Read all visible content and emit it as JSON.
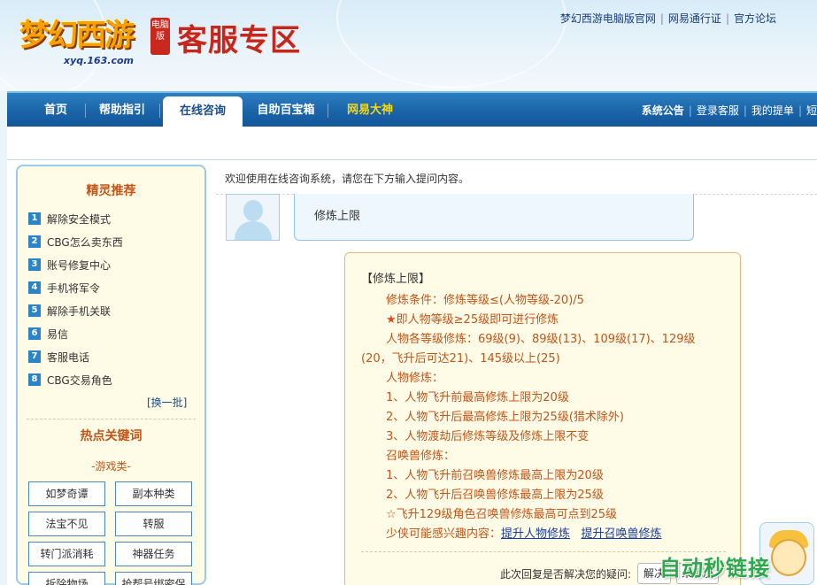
{
  "header": {
    "logo_text": "梦幻西游",
    "logo_badge": "电脑版",
    "logo_url": "xyq.163.com",
    "zone_title": "客服专区",
    "top_links": [
      "梦幻西游电脑版官网",
      "网易通行证",
      "官方论坛"
    ]
  },
  "nav": {
    "tabs": [
      {
        "label": "首页"
      },
      {
        "label": "帮助指引"
      },
      {
        "label": "在线咨询"
      },
      {
        "label": "自助百宝箱"
      },
      {
        "label": "网易大神"
      }
    ],
    "right_links": [
      "系统公告",
      "登录客服",
      "我的提单",
      "短"
    ]
  },
  "sidebar": {
    "rec_title": "精灵推荐",
    "rec_items": [
      {
        "num": "1",
        "label": "解除安全模式"
      },
      {
        "num": "2",
        "label": "CBG怎么卖东西"
      },
      {
        "num": "3",
        "label": "账号修复中心"
      },
      {
        "num": "4",
        "label": "手机将军令"
      },
      {
        "num": "5",
        "label": "解除手机关联"
      },
      {
        "num": "6",
        "label": "易信"
      },
      {
        "num": "7",
        "label": "客服电话"
      },
      {
        "num": "8",
        "label": "CBG交易角色"
      }
    ],
    "more_label": "[换一批]",
    "hot_title": "热点关键词",
    "category_label": "-游戏类-",
    "keywords": [
      "如梦奇谭",
      "副本种类",
      "法宝不见",
      "转服",
      "转门派消耗",
      "神器任务",
      "拆除物场",
      "抢帮号绑密保"
    ]
  },
  "chat": {
    "welcome": "欢迎使用在线咨询系统，请您在下方输入提问内容。",
    "user_message": "修炼上限",
    "answer_title": "【修炼上限】",
    "answer_lines": [
      "修炼条件：修炼等级≤(人物等级-20)/5",
      "即人物等级≥25级即可进行修炼",
      "人物各等级修炼：69级(9)、89级(13)、109级(17)、129级",
      "(20，飞升后可达21)、145级以上(25)",
      "人物修炼：",
      "1、人物飞升前最高修炼上限为20级",
      "2、人物飞升后最高修炼上限为25级(猎术除外)",
      "3、人物渡劫后修炼等级及修炼上限不变",
      "召唤兽修炼：",
      "1、人物飞升前召唤兽修炼最高上限为20级",
      "2、人物飞升后召唤兽修炼最高上限为25级",
      "☆飞升129级角色召唤兽修炼最高可点到25级"
    ],
    "related_label": "少侠可能感兴趣内容：",
    "related_links": [
      "提升人物修炼",
      "提升召唤兽修炼"
    ],
    "feedback_question": "此次回复是否解决您的疑问:",
    "yes_label": "解决",
    "no_label": "未解决"
  },
  "watermark": "自动秒链接"
}
